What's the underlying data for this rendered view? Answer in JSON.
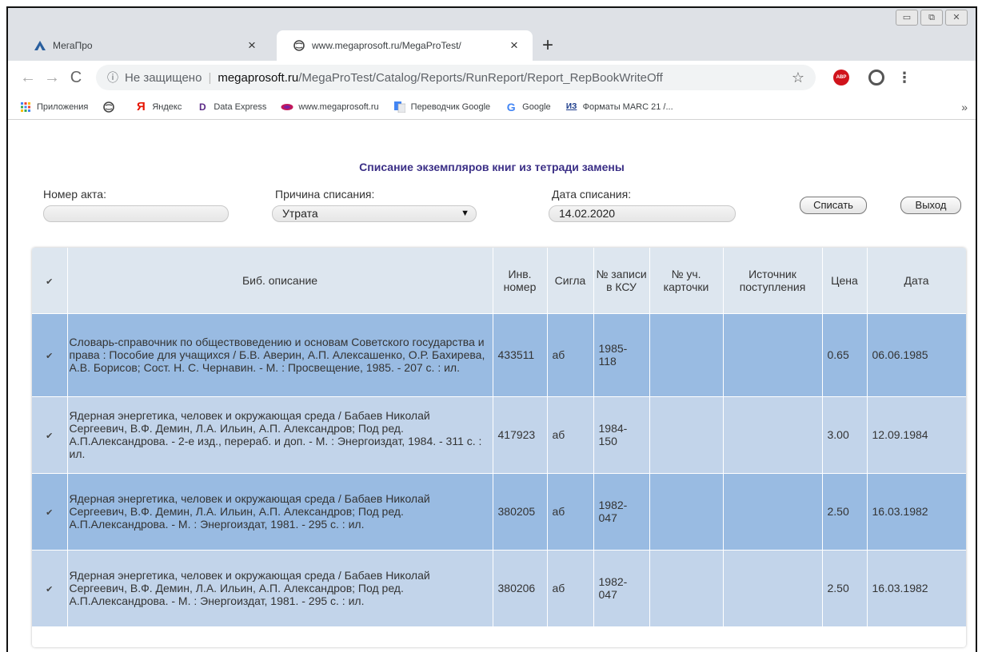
{
  "browser": {
    "tabs": [
      {
        "label": "МегаПро",
        "icon": "megapro-logo-icon"
      },
      {
        "label": "www.megaprosoft.ru/MegaProTest/",
        "icon": "globe-icon"
      }
    ],
    "new_tab": "+",
    "tab_close": "×",
    "window_controls": {
      "minimize": "▭",
      "maximize": "⧉",
      "close": "✕"
    },
    "address": {
      "security": "Не защищено",
      "separator": "|",
      "host": "megaprosoft.ru",
      "path": "/MegaProTest/Catalog/Reports/RunReport/Report_RepBookWriteOff"
    },
    "bookmarks": [
      {
        "label": "Приложения",
        "icon": "apps-grid-icon"
      },
      {
        "label": "",
        "icon": "globe-icon"
      },
      {
        "label": "Яндекс",
        "icon": "yandex-icon"
      },
      {
        "label": "Data Express",
        "icon": "data-express-icon"
      },
      {
        "label": "www.megaprosoft.ru",
        "icon": "megaprosoft-icon"
      },
      {
        "label": "Переводчик Google",
        "icon": "google-translate-icon"
      },
      {
        "label": "Google",
        "icon": "google-icon"
      },
      {
        "label": "Форматы MARC 21 /...",
        "icon": "marc-icon"
      }
    ],
    "bookmarks_more": "»"
  },
  "report": {
    "title": "Списание экземпляров книг из тетради замены",
    "act_number": {
      "label": "Номер акта:",
      "value": ""
    },
    "reason": {
      "label": "Причина списания:",
      "value": "Утрата"
    },
    "date": {
      "label": "Дата списания:",
      "value": "14.02.2020"
    },
    "write_off_button": "Списать",
    "exit_button": "Выход"
  },
  "table": {
    "headers": {
      "check": "✔",
      "desc": "Биб. описание",
      "inv": "Инв. номер",
      "sigla": "Сигла",
      "ksu": "№ записи в КСУ",
      "card": "№ уч. карточки",
      "source": "Источник поступления",
      "price": "Цена",
      "date": "Дата"
    },
    "rows": [
      {
        "checked": "✔",
        "desc": "Словарь-справочник по обществоведению и основам Советского государства и права : Пособие для учащихся / Б.В. Аверин, А.П. Алексашенко, О.Р. Бахирева, А.В. Борисов; Сост. Н. С. Чернавин. - М. : Просвещение, 1985. - 207 с. : ил.",
        "inv": "433511",
        "sigla": "аб",
        "ksu": "1985-118",
        "card": "",
        "source": "",
        "price": "0.65",
        "date": "06.06.1985"
      },
      {
        "checked": "✔",
        "desc": "Ядерная энергетика, человек и окружающая среда / Бабаев Николай Сергеевич, В.Ф. Демин, Л.А. Ильин, А.П. Александров; Под ред. А.П.Александрова. - 2-е изд., перераб. и доп. - М. : Энергоиздат, 1984. - 311 с. : ил.",
        "inv": "417923",
        "sigla": "аб",
        "ksu": "1984-150",
        "card": "",
        "source": "",
        "price": "3.00",
        "date": "12.09.1984"
      },
      {
        "checked": "✔",
        "desc": "Ядерная энергетика, человек и окружающая среда / Бабаев Николай Сергеевич, В.Ф. Демин, Л.А. Ильин, А.П. Александров; Под ред. А.П.Александрова. - М. : Энергоиздат, 1981. - 295 с. : ил.",
        "inv": "380205",
        "sigla": "аб",
        "ksu": "1982-047",
        "card": "",
        "source": "",
        "price": "2.50",
        "date": "16.03.1982"
      },
      {
        "checked": "✔",
        "desc": "Ядерная энергетика, человек и окружающая среда / Бабаев Николай Сергеевич, В.Ф. Демин, Л.А. Ильин, А.П. Александров; Под ред. А.П.Александрова. - М. : Энергоиздат, 1981. - 295 с. : ил.",
        "inv": "380206",
        "sigla": "аб",
        "ksu": "1982-047",
        "card": "",
        "source": "",
        "price": "2.50",
        "date": "16.03.1982"
      }
    ]
  },
  "colors": {
    "row_dark": "#99bbe2",
    "row_light": "#c2d4ea",
    "header_bg": "#dde6ef",
    "title": "#3b2f86"
  }
}
